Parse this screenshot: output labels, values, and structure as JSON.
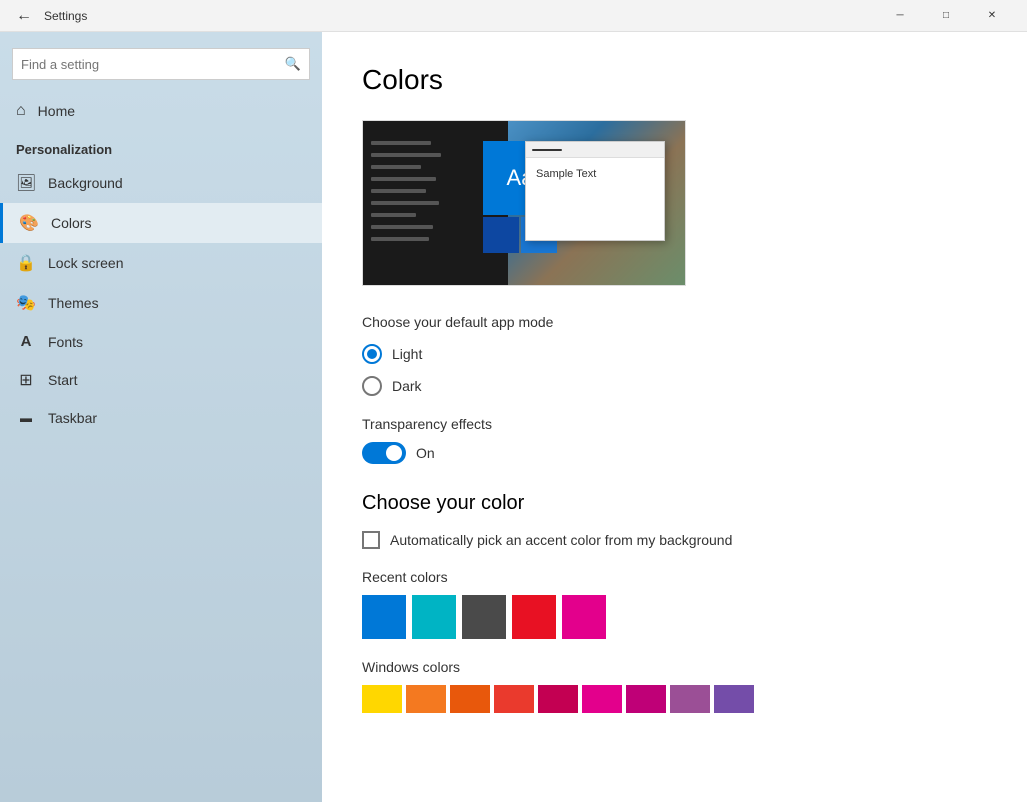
{
  "titlebar": {
    "back_icon": "←",
    "title": "Settings",
    "minimize_label": "─",
    "restore_label": "□",
    "close_label": "✕"
  },
  "sidebar": {
    "search_placeholder": "Find a setting",
    "search_icon": "🔍",
    "home_label": "Home",
    "home_icon": "⌂",
    "section_title": "Personalization",
    "items": [
      {
        "id": "background",
        "label": "Background",
        "icon": "🖼"
      },
      {
        "id": "colors",
        "label": "Colors",
        "icon": "🎨"
      },
      {
        "id": "lock-screen",
        "label": "Lock screen",
        "icon": "🔒"
      },
      {
        "id": "themes",
        "label": "Themes",
        "icon": "🎭"
      },
      {
        "id": "fonts",
        "label": "Fonts",
        "icon": "A"
      },
      {
        "id": "start",
        "label": "Start",
        "icon": "⊞"
      },
      {
        "id": "taskbar",
        "label": "Taskbar",
        "icon": "▬"
      }
    ]
  },
  "content": {
    "page_title": "Colors",
    "preview_sample_text": "Sample Text",
    "tile_label": "Aa",
    "mode_section_label": "Choose your default app mode",
    "mode_options": [
      {
        "id": "light",
        "label": "Light",
        "checked": true
      },
      {
        "id": "dark",
        "label": "Dark",
        "checked": false
      }
    ],
    "transparency_title": "Transparency effects",
    "transparency_state": "On",
    "choose_color_title": "Choose your color",
    "auto_accent_label": "Automatically pick an accent color from my background",
    "recent_colors_label": "Recent colors",
    "recent_colors": [
      "#0078d7",
      "#00b4c4",
      "#4a4a4a",
      "#e81123",
      "#e3008c"
    ],
    "windows_colors_label": "Windows colors",
    "windows_colors": [
      "#ffd700",
      "#f47920",
      "#e8580c",
      "#ea3a2d",
      "#c30052",
      "#e3008c",
      "#bf0077",
      "#9b4f96",
      "#744da9"
    ]
  }
}
